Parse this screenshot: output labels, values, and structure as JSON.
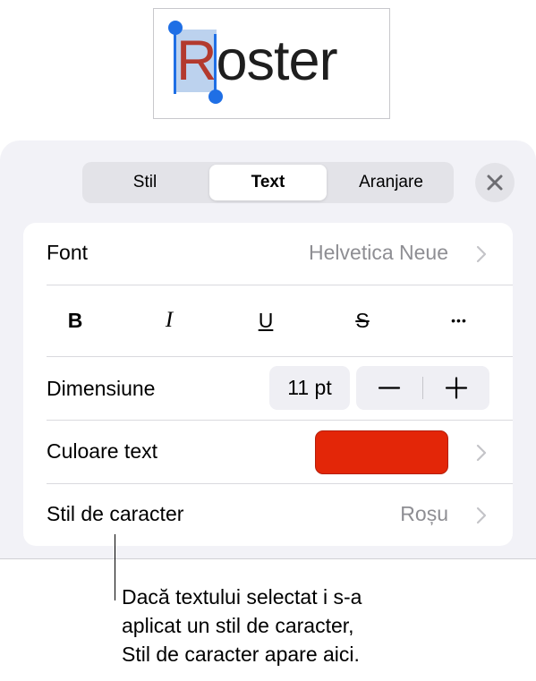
{
  "document": {
    "selected_letter": "R",
    "rest_of_word": "oster"
  },
  "tabs": [
    {
      "label": "Stil",
      "active": false
    },
    {
      "label": "Text",
      "active": true
    },
    {
      "label": "Aranjare",
      "active": false
    }
  ],
  "close_icon": "close-icon",
  "font_row": {
    "label": "Font",
    "value": "Helvetica Neue"
  },
  "style_buttons": {
    "bold": "B",
    "italic": "I",
    "underline": "U",
    "strikethrough": "S",
    "more": "•••"
  },
  "size_row": {
    "label": "Dimensiune",
    "value": "11 pt"
  },
  "color_row": {
    "label": "Culoare text",
    "color": "#e32608"
  },
  "char_style_row": {
    "label": "Stil de caracter",
    "value": "Roșu"
  },
  "callout": {
    "lines": [
      "Dacă textului selectat i s-a",
      "aplicat un stil de caracter,",
      "Stil de caracter apare aici."
    ]
  },
  "colors": {
    "accent_blue": "#1f6fe5",
    "selection_highlight": "#bcd2ee",
    "selected_text_red": "#b33a2e",
    "panel_background": "#f2f2f7",
    "secondary_text": "#8e8e93"
  }
}
